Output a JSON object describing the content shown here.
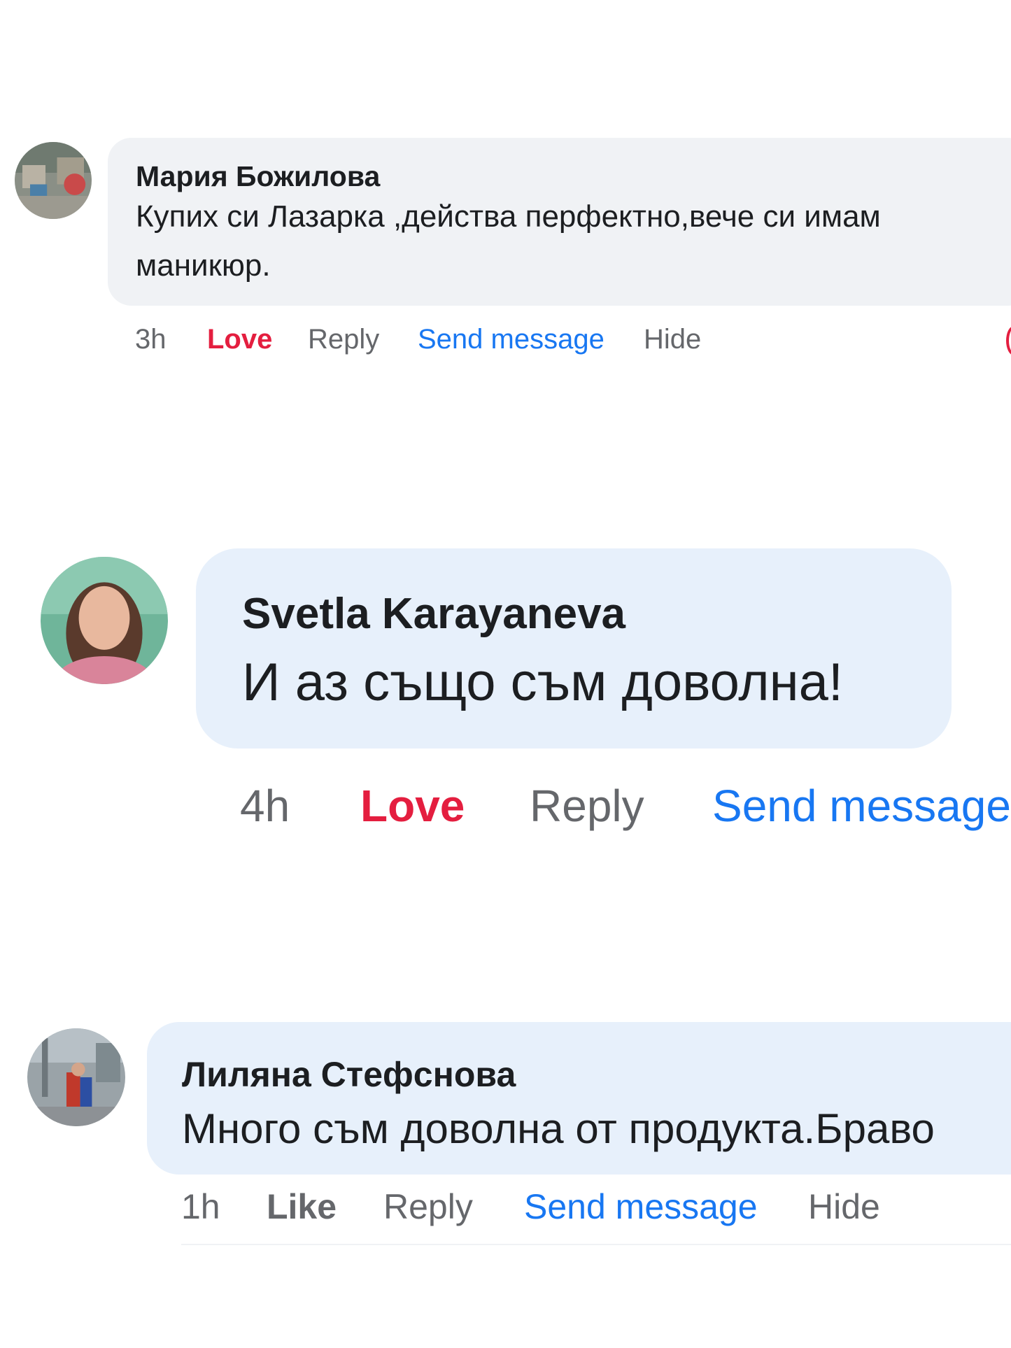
{
  "comments": [
    {
      "author": "Мария Божилова",
      "text_lines": [
        "Купих си Лазарка ,действа перфектно,вече си имам",
        "маникюр."
      ],
      "actions": {
        "time": "3h",
        "reaction": "Love",
        "reply": "Reply",
        "send_message": "Send message",
        "hide": "Hide"
      }
    },
    {
      "author": "Svetla Karayaneva",
      "text_lines": [
        "И аз също съм доволна!"
      ],
      "actions": {
        "time": "4h",
        "reaction": "Love",
        "reply": "Reply",
        "send_message": "Send message"
      }
    },
    {
      "author": "Лиляна Стефснова",
      "text_lines": [
        "Много съм доволна от продукта.Браво"
      ],
      "actions": {
        "time": "1h",
        "reaction": "Like",
        "reply": "Reply",
        "send_message": "Send message",
        "hide": "Hide"
      }
    }
  ],
  "colors": {
    "love": "#e41e3f",
    "link": "#1877f2",
    "muted": "#65676b",
    "bubble_grey": "#f0f2f5",
    "bubble_blue": "#e7f0fb"
  }
}
